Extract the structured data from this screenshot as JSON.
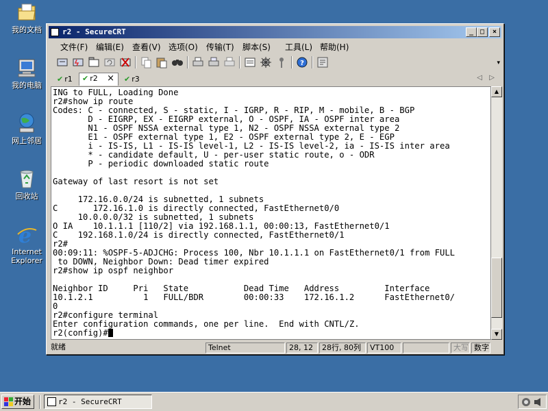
{
  "desktop": {
    "icons": [
      {
        "label": "我的文档",
        "icon": "my-documents-icon"
      },
      {
        "label": "我的电脑",
        "icon": "my-computer-icon"
      },
      {
        "label": "网上邻居",
        "icon": "network-places-icon"
      },
      {
        "label": "回收站",
        "icon": "recycle-bin-icon"
      },
      {
        "label": "Internet Explorer",
        "icon": "internet-explorer-icon"
      }
    ]
  },
  "window": {
    "title": "r2 - SecureCRT",
    "controls": {
      "minimize": "_",
      "maximize": "□",
      "close": "×"
    },
    "menu": [
      "文件(F)",
      "编辑(E)",
      "查看(V)",
      "选项(O)",
      "传输(T)",
      "脚本(S)",
      "工具(L)",
      "帮助(H)"
    ],
    "toolbar_icons": [
      "connect-icon",
      "quick-connect-icon",
      "connect-tab-icon",
      "reconnect-icon",
      "disconnect-icon",
      "copy-icon",
      "paste-icon",
      "find-icon",
      "print-icon",
      "print-selection-icon",
      "print-screen-icon",
      "session-options-icon",
      "global-options-icon",
      "key-map-icon",
      "help-icon",
      "sftp-icon"
    ],
    "tabs": [
      {
        "label": "r1",
        "active": false
      },
      {
        "label": "r2",
        "active": true
      },
      {
        "label": "r3",
        "active": false
      }
    ],
    "tab_close": "×",
    "tab_nav": [
      "◁",
      "▷"
    ],
    "terminal": {
      "lines": [
        "ING to FULL, Loading Done",
        "r2#show ip route",
        "Codes: C - connected, S - static, I - IGRP, R - RIP, M - mobile, B - BGP",
        "       D - EIGRP, EX - EIGRP external, O - OSPF, IA - OSPF inter area",
        "       N1 - OSPF NSSA external type 1, N2 - OSPF NSSA external type 2",
        "       E1 - OSPF external type 1, E2 - OSPF external type 2, E - EGP",
        "       i - IS-IS, L1 - IS-IS level-1, L2 - IS-IS level-2, ia - IS-IS inter area",
        "       * - candidate default, U - per-user static route, o - ODR",
        "       P - periodic downloaded static route",
        "",
        "Gateway of last resort is not set",
        "",
        "     172.16.0.0/24 is subnetted, 1 subnets",
        "C       172.16.1.0 is directly connected, FastEthernet0/0",
        "     10.0.0.0/32 is subnetted, 1 subnets",
        "O IA    10.1.1.1 [110/2] via 192.168.1.1, 00:00:13, FastEthernet0/1",
        "C    192.168.1.0/24 is directly connected, FastEthernet0/1",
        "r2#",
        "00:09:11: %OSPF-5-ADJCHG: Process 100, Nbr 10.1.1.1 on FastEthernet0/1 from FULL",
        " to DOWN, Neighbor Down: Dead timer expired",
        "r2#show ip ospf neighbor",
        "",
        "Neighbor ID     Pri   State           Dead Time   Address         Interface",
        "10.1.2.1          1   FULL/BDR        00:00:33    172.16.1.2      FastEthernet0/",
        "0",
        "r2#configure terminal",
        "Enter configuration commands, one per line.  End with CNTL/Z.",
        "r2(config)#"
      ]
    },
    "scrollbar": {
      "up": "▲",
      "down": "▼"
    },
    "status": {
      "ready": "就绪",
      "protocol": "Telnet",
      "cursor_pos": "28, 12",
      "size": "28行, 80列",
      "emulation": "VT100",
      "caps": "大写",
      "num": "数字"
    }
  },
  "taskbar": {
    "start": "开始",
    "task": "r2 - SecureCRT"
  }
}
